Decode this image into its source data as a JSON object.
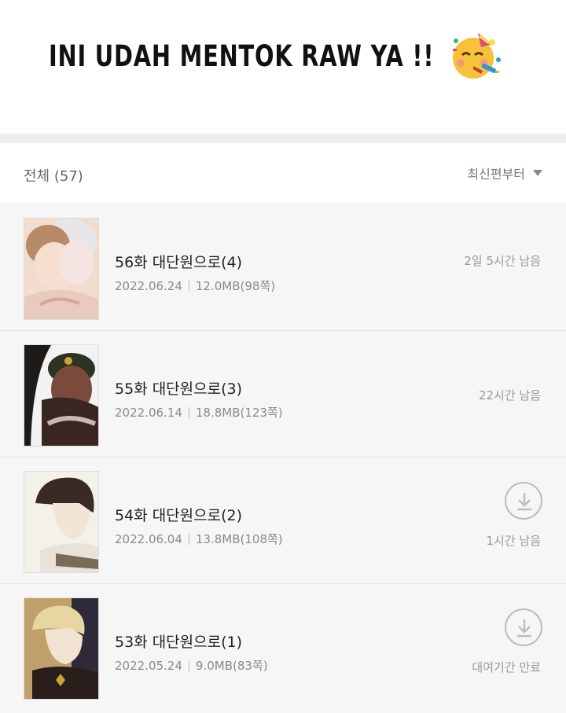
{
  "banner": {
    "text": "INI UDAH MENTOK RAW YA !!",
    "emoji_icon": "partying-face-icon"
  },
  "header": {
    "count_label": "전체 (57)",
    "sort_label": "최신편부터",
    "sort_icon": "triangle-down-icon"
  },
  "episodes": [
    {
      "title": "56화 대단원으로(4)",
      "date": "2022.06.24",
      "size": "12.0MB(98쪽)",
      "status": "2일 5시간 남음",
      "download_icon": false
    },
    {
      "title": "55화 대단원으로(3)",
      "date": "2022.06.14",
      "size": "18.8MB(123쪽)",
      "status": "22시간 남음",
      "download_icon": false
    },
    {
      "title": "54화 대단원으로(2)",
      "date": "2022.06.04",
      "size": "13.8MB(108쪽)",
      "status": "1시간 남음",
      "download_icon": true
    },
    {
      "title": "53화 대단원으로(1)",
      "date": "2022.05.24",
      "size": "9.0MB(83쪽)",
      "status": "대여기간 만료",
      "download_icon": true
    }
  ],
  "colors": {
    "background": "#f6f6f6",
    "divider": "#e4e4e4",
    "muted_text": "#8a8a8a"
  }
}
